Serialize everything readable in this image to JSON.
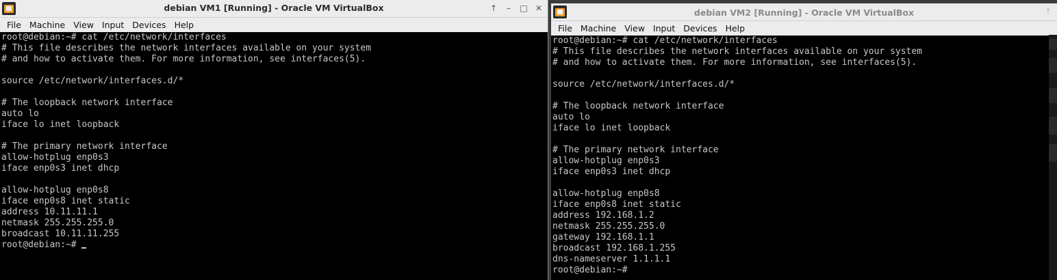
{
  "vm1": {
    "title": "debian VM1 [Running] - Oracle VM VirtualBox",
    "menu": [
      "File",
      "Machine",
      "View",
      "Input",
      "Devices",
      "Help"
    ],
    "controls": [
      "↑",
      "–",
      "□",
      "✕"
    ],
    "terminal_lines": [
      "root@debian:~# cat /etc/network/interfaces",
      "# This file describes the network interfaces available on your system",
      "# and how to activate them. For more information, see interfaces(5).",
      "",
      "source /etc/network/interfaces.d/*",
      "",
      "# The loopback network interface",
      "auto lo",
      "iface lo inet loopback",
      "",
      "# The primary network interface",
      "allow-hotplug enp0s3",
      "iface enp0s3 inet dhcp",
      "",
      "allow-hotplug enp0s8",
      "iface enp0s8 inet static",
      "address 10.11.11.1",
      "netmask 255.255.255.0",
      "broadcast 10.11.11.255"
    ],
    "prompt": "root@debian:~# "
  },
  "vm2": {
    "title": "debian VM2 [Running] - Oracle VM VirtualBox",
    "menu": [
      "File",
      "Machine",
      "View",
      "Input",
      "Devices",
      "Help"
    ],
    "controls": [
      "↑"
    ],
    "terminal_lines": [
      "root@debian:~# cat /etc/network/interfaces",
      "# This file describes the network interfaces available on your system",
      "# and how to activate them. For more information, see interfaces(5).",
      "",
      "source /etc/network/interfaces.d/*",
      "",
      "# The loopback network interface",
      "auto lo",
      "iface lo inet loopback",
      "",
      "# The primary network interface",
      "allow-hotplug enp0s3",
      "iface enp0s3 inet dhcp",
      "",
      "allow-hotplug enp0s8",
      "iface enp0s8 inet static",
      "address 192.168.1.2",
      "netmask 255.255.255.0",
      "gateway 192.168.1.1",
      "broadcast 192.168.1.255",
      "dns-nameserver 1.1.1.1"
    ],
    "prompt": "root@debian:~#"
  }
}
